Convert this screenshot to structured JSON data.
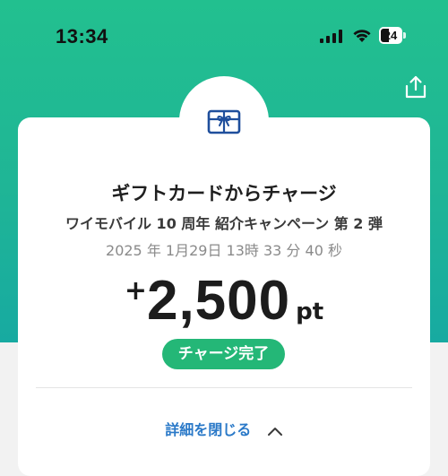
{
  "status_bar": {
    "time": "13:34",
    "battery_level": "24"
  },
  "header": {
    "share_icon": "share-icon"
  },
  "transaction": {
    "icon": "gift-card-icon",
    "title": "ギフトカードからチャージ",
    "campaign": "ワイモバイル 10 周年 紹介キャンペーン 第 2 弾",
    "datetime": "2025 年 1月29日 13時 33 分 40 秒",
    "amount_sign": "+",
    "amount": "2,500",
    "unit": "pt",
    "status": "チャージ完了"
  },
  "details": {
    "toggle_label": "詳細を閉じる",
    "toggle_icon": "chevron-up-icon"
  },
  "colors": {
    "header_gradient_top": "#22c08f",
    "header_gradient_bottom": "#17aaa1",
    "status_green": "#24b777",
    "link_blue": "#2a79c8",
    "gift_icon_blue": "#1f4f9c"
  }
}
